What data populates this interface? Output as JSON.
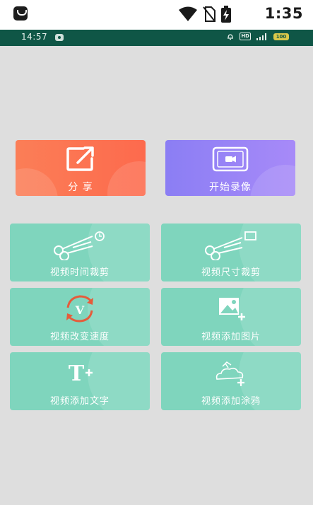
{
  "system_status": {
    "time": "1:35"
  },
  "recording_status": {
    "time": "14:57",
    "hd_badge": "HD",
    "battery": "100"
  },
  "actions": {
    "share": {
      "label": "分 享",
      "icon": "share-icon"
    },
    "record": {
      "label": "开始录像",
      "icon": "camera-record-icon"
    }
  },
  "features": [
    {
      "label": "视频时间裁剪",
      "icon": "scissors-clock-icon"
    },
    {
      "label": "视频尺寸裁剪",
      "icon": "scissors-frame-icon"
    },
    {
      "label": "视频改变速度",
      "icon": "speed-cycle-icon"
    },
    {
      "label": "视频添加图片",
      "icon": "add-image-icon"
    },
    {
      "label": "视频添加文字",
      "icon": "add-text-icon"
    },
    {
      "label": "视频添加涂鸦",
      "icon": "add-doodle-icon"
    }
  ],
  "colors": {
    "share": "#fd6a4d",
    "record": "#9a84f6",
    "feature": "#7fd5bd",
    "statusbar": "#0f5646"
  }
}
